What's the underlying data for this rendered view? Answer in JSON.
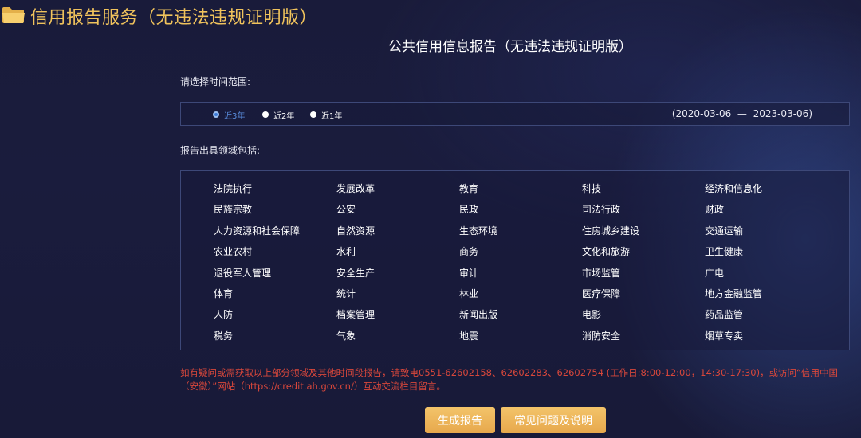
{
  "header": {
    "title": "信用报告服务（无违法违规证明版）",
    "icon": "folder-icon",
    "title_color": "#f0c35c"
  },
  "report_title": "公共信用信息报告（无违法违规证明版）",
  "time_range": {
    "label": "请选择时间范围:",
    "options": [
      {
        "label": "近3年",
        "selected": true
      },
      {
        "label": "近2年",
        "selected": false
      },
      {
        "label": "近1年",
        "selected": false
      }
    ],
    "start_date": "2020-03-06",
    "separator": "—",
    "end_date": "2023-03-06"
  },
  "domains": {
    "label": "报告出具领域包括:",
    "items": [
      "法院执行",
      "发展改革",
      "教育",
      "科技",
      "经济和信息化",
      "民族宗教",
      "公安",
      "民政",
      "司法行政",
      "财政",
      "人力资源和社会保障",
      "自然资源",
      "生态环境",
      "住房城乡建设",
      "交通运输",
      "农业农村",
      "水利",
      "商务",
      "文化和旅游",
      "卫生健康",
      "退役军人管理",
      "安全生产",
      "审计",
      "市场监管",
      "广电",
      "体育",
      "统计",
      "林业",
      "医疗保障",
      "地方金融监管",
      "人防",
      "档案管理",
      "新闻出版",
      "电影",
      "药品监管",
      "税务",
      "气象",
      "地震",
      "消防安全",
      "烟草专卖"
    ]
  },
  "notice": "如有疑问或需获取以上部分领域及其他时间段报告，请致电0551-62602158、62602283、62602754 (工作日:8:00-12:00，14:30-17:30)，或访问“信用中国（安徽）”网站（https://credit.ah.gov.cn/）互动交流栏目留言。",
  "buttons": {
    "generate": "生成报告",
    "faq": "常见问题及说明"
  },
  "colors": {
    "background": "#1a1c3d",
    "accent": "#f0c35c",
    "button": "#eeb85e",
    "notice": "#d8473b",
    "selected_radio": "#3d7bd8"
  }
}
